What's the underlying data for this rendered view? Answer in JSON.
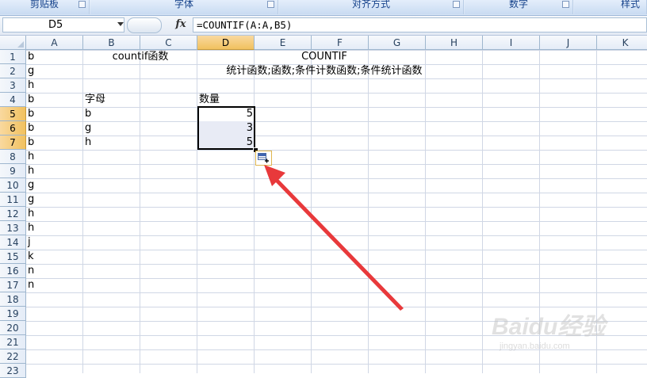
{
  "ribbon": {
    "groups": [
      "剪贴板",
      "字体",
      "对齐方式",
      "数字",
      "样式"
    ]
  },
  "formula_bar": {
    "name_box": "D5",
    "fx_label": "fx",
    "formula": "=COUNTIF(A:A,B5)"
  },
  "columns": [
    "A",
    "B",
    "C",
    "D",
    "E",
    "F",
    "G",
    "H",
    "I",
    "J",
    "K"
  ],
  "rows": [
    "1",
    "2",
    "3",
    "4",
    "5",
    "6",
    "7",
    "8",
    "9",
    "10",
    "11",
    "12",
    "13",
    "14",
    "15",
    "16",
    "17",
    "18",
    "19",
    "20",
    "21",
    "22",
    "23"
  ],
  "selected_column": "D",
  "selected_rows": [
    "5",
    "6",
    "7"
  ],
  "column_a_values": [
    "b",
    "g",
    "h",
    "b",
    "b",
    "b",
    "b",
    "h",
    "h",
    "g",
    "g",
    "h",
    "h",
    "j",
    "k",
    "n",
    "n"
  ],
  "title_cell": "countif函数",
  "info": {
    "name": "COUNTIF",
    "description": "统计函数;函数;条件计数函数;条件统计函数"
  },
  "table": {
    "header_letter": "字母",
    "header_count": "数量",
    "letters": [
      "b",
      "g",
      "h"
    ],
    "counts": [
      "5",
      "3",
      "5"
    ]
  },
  "colors": {
    "selection_header": "#f1c15f",
    "arrow": "#e8393b",
    "range_fill": "#e8ebf5"
  },
  "watermark": {
    "brand": "Baidu经验",
    "url": "jingyan.baidu.com"
  }
}
